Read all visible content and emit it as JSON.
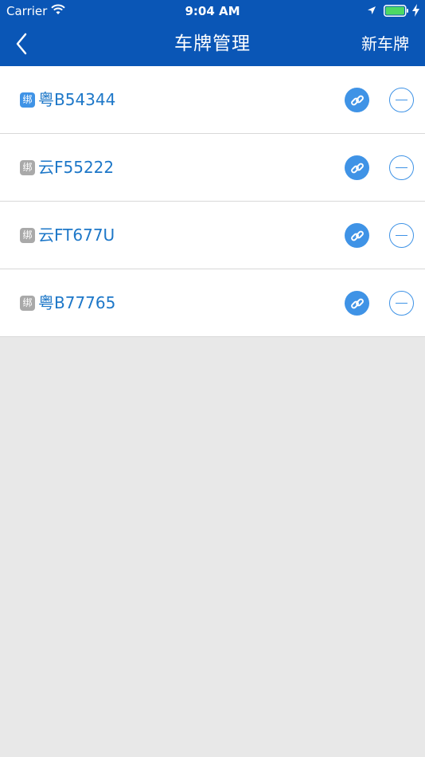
{
  "status_bar": {
    "carrier": "Carrier",
    "time": "9:04 AM"
  },
  "nav": {
    "title": "车牌管理",
    "new_plate_label": "新车牌",
    "back_icon": "chevron-left-icon"
  },
  "colors": {
    "nav_background": "#0a56b6",
    "accent": "#3f93e6",
    "plate_text": "#1d77c8",
    "badge_inactive": "#a9a9a9",
    "page_background": "#e8e8e8"
  },
  "plates": [
    {
      "badge": "绑",
      "bound": true,
      "plate": "粤B54344"
    },
    {
      "badge": "绑",
      "bound": false,
      "plate": "云F55222"
    },
    {
      "badge": "绑",
      "bound": false,
      "plate": "云FT677U"
    },
    {
      "badge": "绑",
      "bound": false,
      "plate": "粤B77765"
    }
  ]
}
